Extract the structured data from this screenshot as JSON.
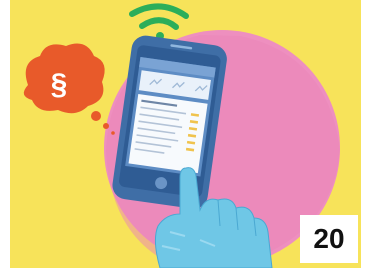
{
  "illustration": {
    "thought_symbol": "§",
    "page_number": "20",
    "icons": [
      "wifi-icon",
      "thought-bubble-icon",
      "smartphone-icon",
      "pointing-hand-icon"
    ],
    "colors": {
      "background": "#f7e35a",
      "circle": "#ee8fbf",
      "bubble": "#e85a2a",
      "phone": "#3f6ea6",
      "wifi": "#2cae5a",
      "hand": "#6fc7e6"
    }
  }
}
